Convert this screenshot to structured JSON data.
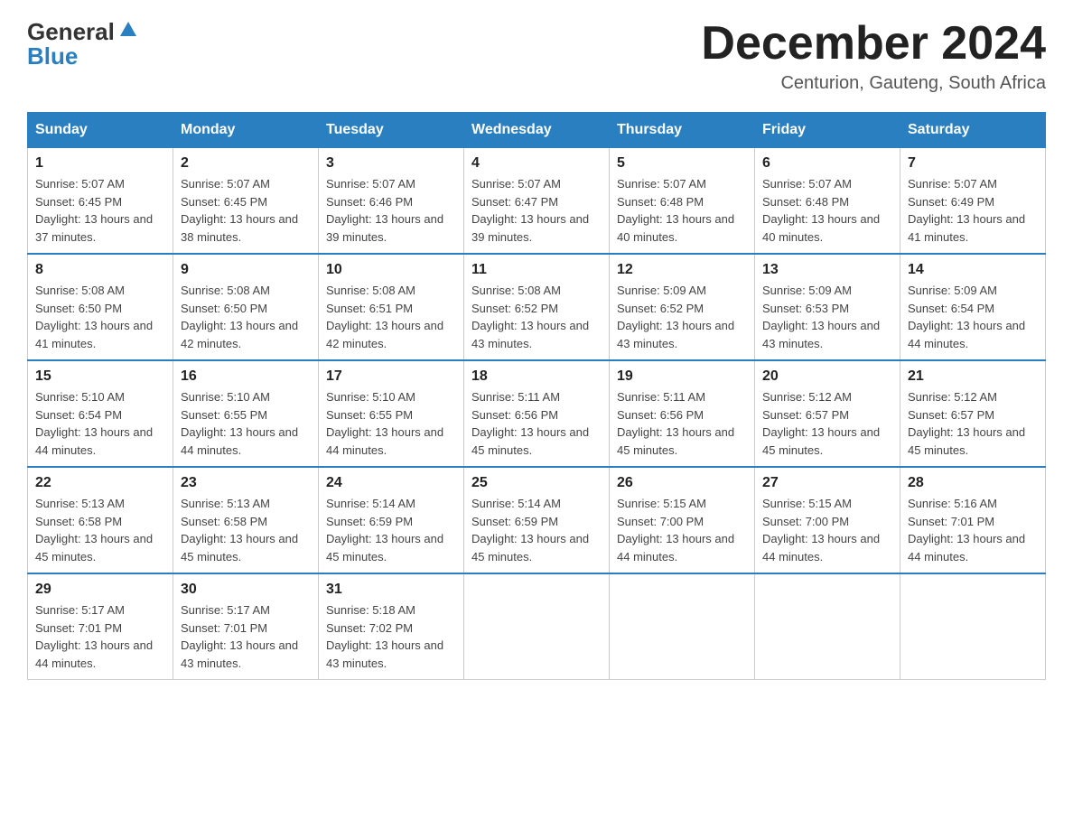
{
  "header": {
    "logo_general": "General",
    "logo_blue": "Blue",
    "month_title": "December 2024",
    "location": "Centurion, Gauteng, South Africa"
  },
  "days_of_week": [
    "Sunday",
    "Monday",
    "Tuesday",
    "Wednesday",
    "Thursday",
    "Friday",
    "Saturday"
  ],
  "weeks": [
    [
      {
        "day": "1",
        "sunrise": "Sunrise: 5:07 AM",
        "sunset": "Sunset: 6:45 PM",
        "daylight": "Daylight: 13 hours and 37 minutes."
      },
      {
        "day": "2",
        "sunrise": "Sunrise: 5:07 AM",
        "sunset": "Sunset: 6:45 PM",
        "daylight": "Daylight: 13 hours and 38 minutes."
      },
      {
        "day": "3",
        "sunrise": "Sunrise: 5:07 AM",
        "sunset": "Sunset: 6:46 PM",
        "daylight": "Daylight: 13 hours and 39 minutes."
      },
      {
        "day": "4",
        "sunrise": "Sunrise: 5:07 AM",
        "sunset": "Sunset: 6:47 PM",
        "daylight": "Daylight: 13 hours and 39 minutes."
      },
      {
        "day": "5",
        "sunrise": "Sunrise: 5:07 AM",
        "sunset": "Sunset: 6:48 PM",
        "daylight": "Daylight: 13 hours and 40 minutes."
      },
      {
        "day": "6",
        "sunrise": "Sunrise: 5:07 AM",
        "sunset": "Sunset: 6:48 PM",
        "daylight": "Daylight: 13 hours and 40 minutes."
      },
      {
        "day": "7",
        "sunrise": "Sunrise: 5:07 AM",
        "sunset": "Sunset: 6:49 PM",
        "daylight": "Daylight: 13 hours and 41 minutes."
      }
    ],
    [
      {
        "day": "8",
        "sunrise": "Sunrise: 5:08 AM",
        "sunset": "Sunset: 6:50 PM",
        "daylight": "Daylight: 13 hours and 41 minutes."
      },
      {
        "day": "9",
        "sunrise": "Sunrise: 5:08 AM",
        "sunset": "Sunset: 6:50 PM",
        "daylight": "Daylight: 13 hours and 42 minutes."
      },
      {
        "day": "10",
        "sunrise": "Sunrise: 5:08 AM",
        "sunset": "Sunset: 6:51 PM",
        "daylight": "Daylight: 13 hours and 42 minutes."
      },
      {
        "day": "11",
        "sunrise": "Sunrise: 5:08 AM",
        "sunset": "Sunset: 6:52 PM",
        "daylight": "Daylight: 13 hours and 43 minutes."
      },
      {
        "day": "12",
        "sunrise": "Sunrise: 5:09 AM",
        "sunset": "Sunset: 6:52 PM",
        "daylight": "Daylight: 13 hours and 43 minutes."
      },
      {
        "day": "13",
        "sunrise": "Sunrise: 5:09 AM",
        "sunset": "Sunset: 6:53 PM",
        "daylight": "Daylight: 13 hours and 43 minutes."
      },
      {
        "day": "14",
        "sunrise": "Sunrise: 5:09 AM",
        "sunset": "Sunset: 6:54 PM",
        "daylight": "Daylight: 13 hours and 44 minutes."
      }
    ],
    [
      {
        "day": "15",
        "sunrise": "Sunrise: 5:10 AM",
        "sunset": "Sunset: 6:54 PM",
        "daylight": "Daylight: 13 hours and 44 minutes."
      },
      {
        "day": "16",
        "sunrise": "Sunrise: 5:10 AM",
        "sunset": "Sunset: 6:55 PM",
        "daylight": "Daylight: 13 hours and 44 minutes."
      },
      {
        "day": "17",
        "sunrise": "Sunrise: 5:10 AM",
        "sunset": "Sunset: 6:55 PM",
        "daylight": "Daylight: 13 hours and 44 minutes."
      },
      {
        "day": "18",
        "sunrise": "Sunrise: 5:11 AM",
        "sunset": "Sunset: 6:56 PM",
        "daylight": "Daylight: 13 hours and 45 minutes."
      },
      {
        "day": "19",
        "sunrise": "Sunrise: 5:11 AM",
        "sunset": "Sunset: 6:56 PM",
        "daylight": "Daylight: 13 hours and 45 minutes."
      },
      {
        "day": "20",
        "sunrise": "Sunrise: 5:12 AM",
        "sunset": "Sunset: 6:57 PM",
        "daylight": "Daylight: 13 hours and 45 minutes."
      },
      {
        "day": "21",
        "sunrise": "Sunrise: 5:12 AM",
        "sunset": "Sunset: 6:57 PM",
        "daylight": "Daylight: 13 hours and 45 minutes."
      }
    ],
    [
      {
        "day": "22",
        "sunrise": "Sunrise: 5:13 AM",
        "sunset": "Sunset: 6:58 PM",
        "daylight": "Daylight: 13 hours and 45 minutes."
      },
      {
        "day": "23",
        "sunrise": "Sunrise: 5:13 AM",
        "sunset": "Sunset: 6:58 PM",
        "daylight": "Daylight: 13 hours and 45 minutes."
      },
      {
        "day": "24",
        "sunrise": "Sunrise: 5:14 AM",
        "sunset": "Sunset: 6:59 PM",
        "daylight": "Daylight: 13 hours and 45 minutes."
      },
      {
        "day": "25",
        "sunrise": "Sunrise: 5:14 AM",
        "sunset": "Sunset: 6:59 PM",
        "daylight": "Daylight: 13 hours and 45 minutes."
      },
      {
        "day": "26",
        "sunrise": "Sunrise: 5:15 AM",
        "sunset": "Sunset: 7:00 PM",
        "daylight": "Daylight: 13 hours and 44 minutes."
      },
      {
        "day": "27",
        "sunrise": "Sunrise: 5:15 AM",
        "sunset": "Sunset: 7:00 PM",
        "daylight": "Daylight: 13 hours and 44 minutes."
      },
      {
        "day": "28",
        "sunrise": "Sunrise: 5:16 AM",
        "sunset": "Sunset: 7:01 PM",
        "daylight": "Daylight: 13 hours and 44 minutes."
      }
    ],
    [
      {
        "day": "29",
        "sunrise": "Sunrise: 5:17 AM",
        "sunset": "Sunset: 7:01 PM",
        "daylight": "Daylight: 13 hours and 44 minutes."
      },
      {
        "day": "30",
        "sunrise": "Sunrise: 5:17 AM",
        "sunset": "Sunset: 7:01 PM",
        "daylight": "Daylight: 13 hours and 43 minutes."
      },
      {
        "day": "31",
        "sunrise": "Sunrise: 5:18 AM",
        "sunset": "Sunset: 7:02 PM",
        "daylight": "Daylight: 13 hours and 43 minutes."
      },
      null,
      null,
      null,
      null
    ]
  ]
}
